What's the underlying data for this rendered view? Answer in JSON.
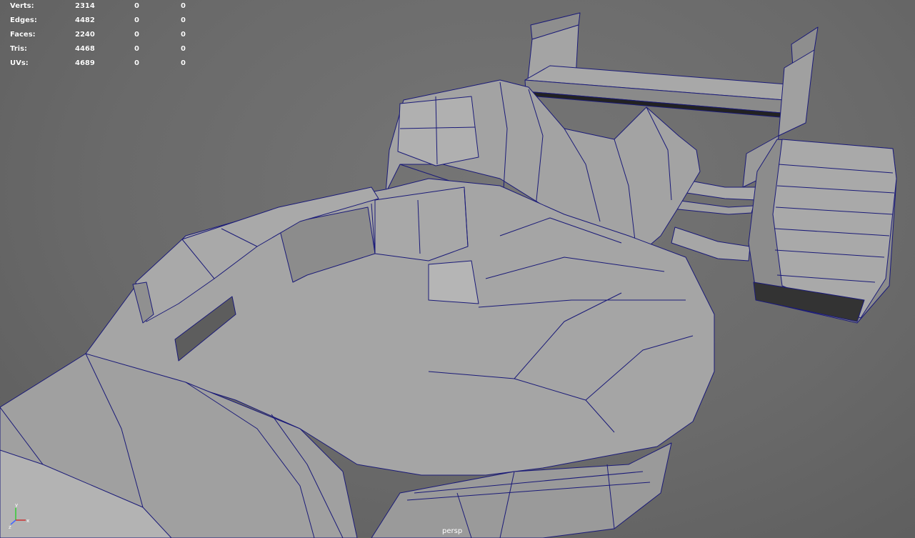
{
  "hud": {
    "rows": [
      {
        "label": "Verts:",
        "values": [
          "2314",
          "0",
          "0"
        ]
      },
      {
        "label": "Edges:",
        "values": [
          "4482",
          "0",
          "0"
        ]
      },
      {
        "label": "Faces:",
        "values": [
          "2240",
          "0",
          "0"
        ]
      },
      {
        "label": "Tris:",
        "values": [
          "4468",
          "0",
          "0"
        ]
      },
      {
        "label": "UVs:",
        "values": [
          "4689",
          "0",
          "0"
        ]
      }
    ]
  },
  "viewport": {
    "camera": "persp",
    "wire_color": "#1a1a78",
    "shade_color": "#9a9a9a"
  },
  "axis": {
    "x": "x",
    "y": "y",
    "z": "z"
  }
}
